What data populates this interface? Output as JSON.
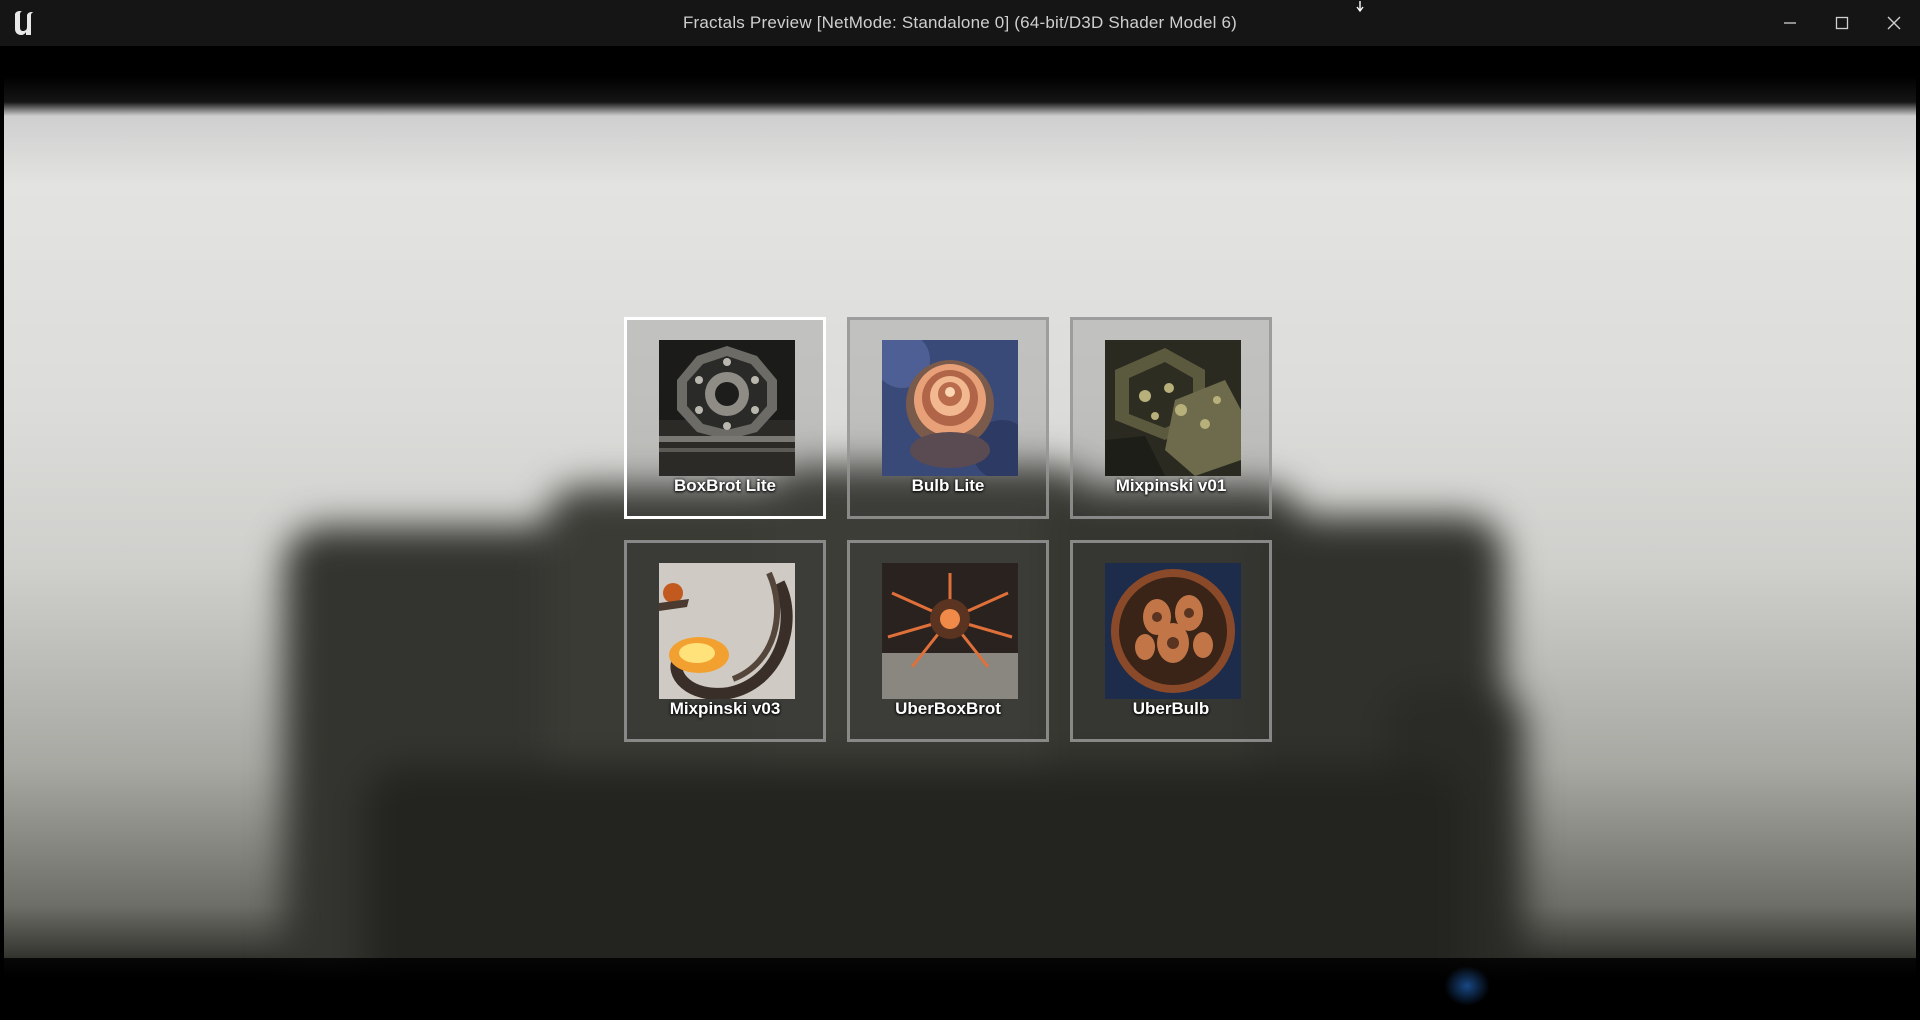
{
  "window": {
    "title": "Fractals Preview [NetMode: Standalone 0]  (64-bit/D3D Shader Model 6)",
    "logo_icon": "unreal-engine-logo-icon",
    "controls": [
      {
        "name": "minimize",
        "icon": "minimize-icon"
      },
      {
        "name": "maximize",
        "icon": "maximize-icon"
      },
      {
        "name": "close",
        "icon": "close-icon"
      }
    ]
  },
  "level_select": {
    "selected_index": 0,
    "tiles": [
      {
        "label": "BoxBrot Lite",
        "thumbnail": "boxbrot-lite-thumbnail"
      },
      {
        "label": "Bulb Lite",
        "thumbnail": "bulb-lite-thumbnail"
      },
      {
        "label": "Mixpinski v01",
        "thumbnail": "mixpinski-v01-thumbnail"
      },
      {
        "label": "Mixpinski v03",
        "thumbnail": "mixpinski-v03-thumbnail"
      },
      {
        "label": "UberBoxBrot",
        "thumbnail": "uberboxbrot-thumbnail"
      },
      {
        "label": "UberBulb",
        "thumbnail": "uberbulb-thumbnail"
      }
    ]
  },
  "colors": {
    "titlebar_bg": "#151515",
    "tile_border": "#969696",
    "tile_border_selected": "#ffffff"
  }
}
